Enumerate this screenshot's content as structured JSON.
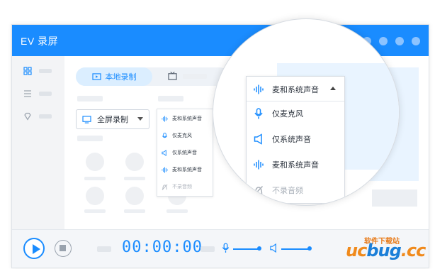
{
  "window": {
    "title": "EV 录屏"
  },
  "tabs": {
    "local_record": "本地录制"
  },
  "record_mode": {
    "selected": "全屏录制"
  },
  "audio_menu_small": {
    "items": [
      "麦和系统声音",
      "仅麦克风",
      "仅系统声音",
      "麦和系统声音",
      "不录音频"
    ]
  },
  "audio_menu_large": {
    "selected": "麦和系统声音",
    "items": [
      "仅麦克风",
      "仅系统声音",
      "麦和系统声音",
      "不录音频"
    ]
  },
  "bottombar": {
    "timer": "00:00:00"
  },
  "watermark": {
    "line1": "软件下载站",
    "logo_a": "uc",
    "logo_b": "bug",
    "logo_c": ".cc"
  },
  "colors": {
    "accent": "#1a8cff",
    "sidebar": "#f3f4f6",
    "watermark_orange": "#f08a1c"
  }
}
